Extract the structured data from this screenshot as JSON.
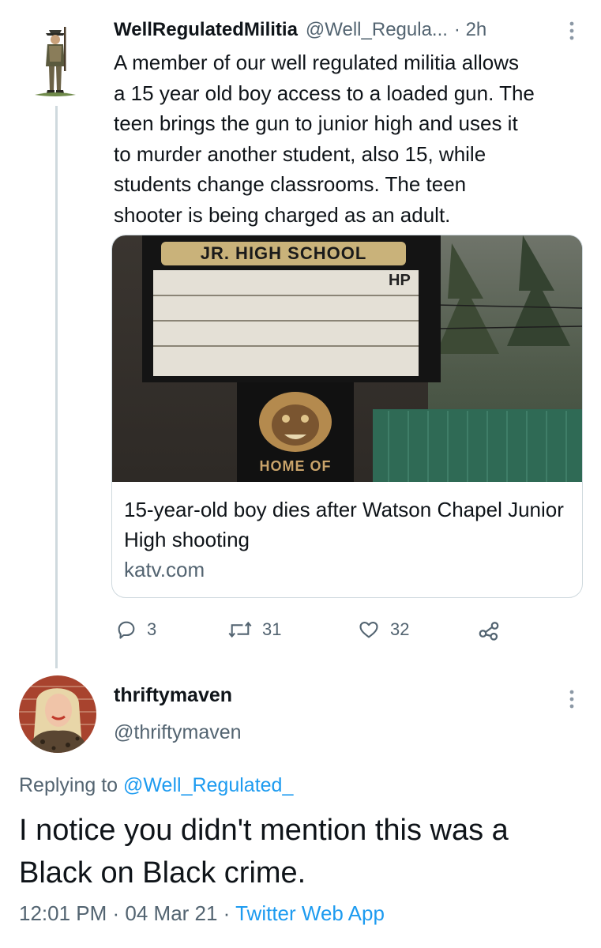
{
  "tweet": {
    "author_name": "WellRegulatedMilitia",
    "author_handle": "@Well_Regula...",
    "time": "· 2h",
    "text": "A member of our well regulated militia allows\na 15 year old boy access to a loaded gun. The\nteen brings the gun to junior high and uses it\nto murder another student, also 15, while\nstudents change classrooms. The teen\nshooter is being charged as an adult.",
    "card": {
      "sign_top": "JR. HIGH SCHOOL",
      "sign_letters": "HP",
      "sign_bottom": "HOME OF",
      "title": "15-year-old boy dies after Watson Chapel Junior High shooting",
      "domain": "katv.com"
    },
    "actions": {
      "replies": "3",
      "retweets": "31",
      "likes": "32"
    }
  },
  "reply": {
    "author_name": "thriftymaven",
    "author_handle": "@thriftymaven",
    "replying_prefix": "Replying to ",
    "replying_target": "@Well_Regulated_",
    "text": "I notice you didn't mention this was a Black on Black crime.",
    "time_date": "12:01 PM · 04 Mar 21 · ",
    "source": "Twitter Web App"
  },
  "colors": {
    "text_primary": "#0f1419",
    "text_secondary": "#536471",
    "link": "#1d9bf0",
    "border": "#cfd9de"
  },
  "icons": [
    "reply-icon",
    "retweet-icon",
    "like-icon",
    "share-icon",
    "more-vertical-icon"
  ]
}
